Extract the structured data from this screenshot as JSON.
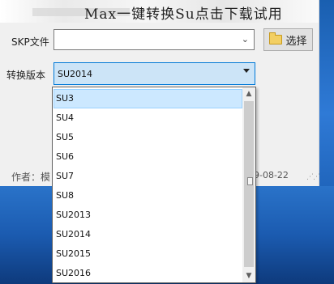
{
  "banner": {
    "title": "Max一键转换Su点击下载试用"
  },
  "skp": {
    "label": "SKP文件",
    "value": "",
    "browse_label": "选择"
  },
  "version": {
    "label": "转换版本",
    "selected": "SU2014"
  },
  "footer": {
    "author": "作者：模",
    "date": "9-08-22"
  },
  "dropdown": {
    "items": [
      {
        "label": "SU3"
      },
      {
        "label": "SU4"
      },
      {
        "label": "SU5"
      },
      {
        "label": "SU6"
      },
      {
        "label": "SU7"
      },
      {
        "label": "SU8"
      },
      {
        "label": "SU2013"
      },
      {
        "label": "SU2014"
      },
      {
        "label": "SU2015"
      },
      {
        "label": "SU2016"
      }
    ],
    "highlighted_index": 0
  },
  "icons": {
    "browse": "folder-icon",
    "field_dropdown": "chevron-down-icon",
    "select_arrow": "triangle-down-icon"
  }
}
